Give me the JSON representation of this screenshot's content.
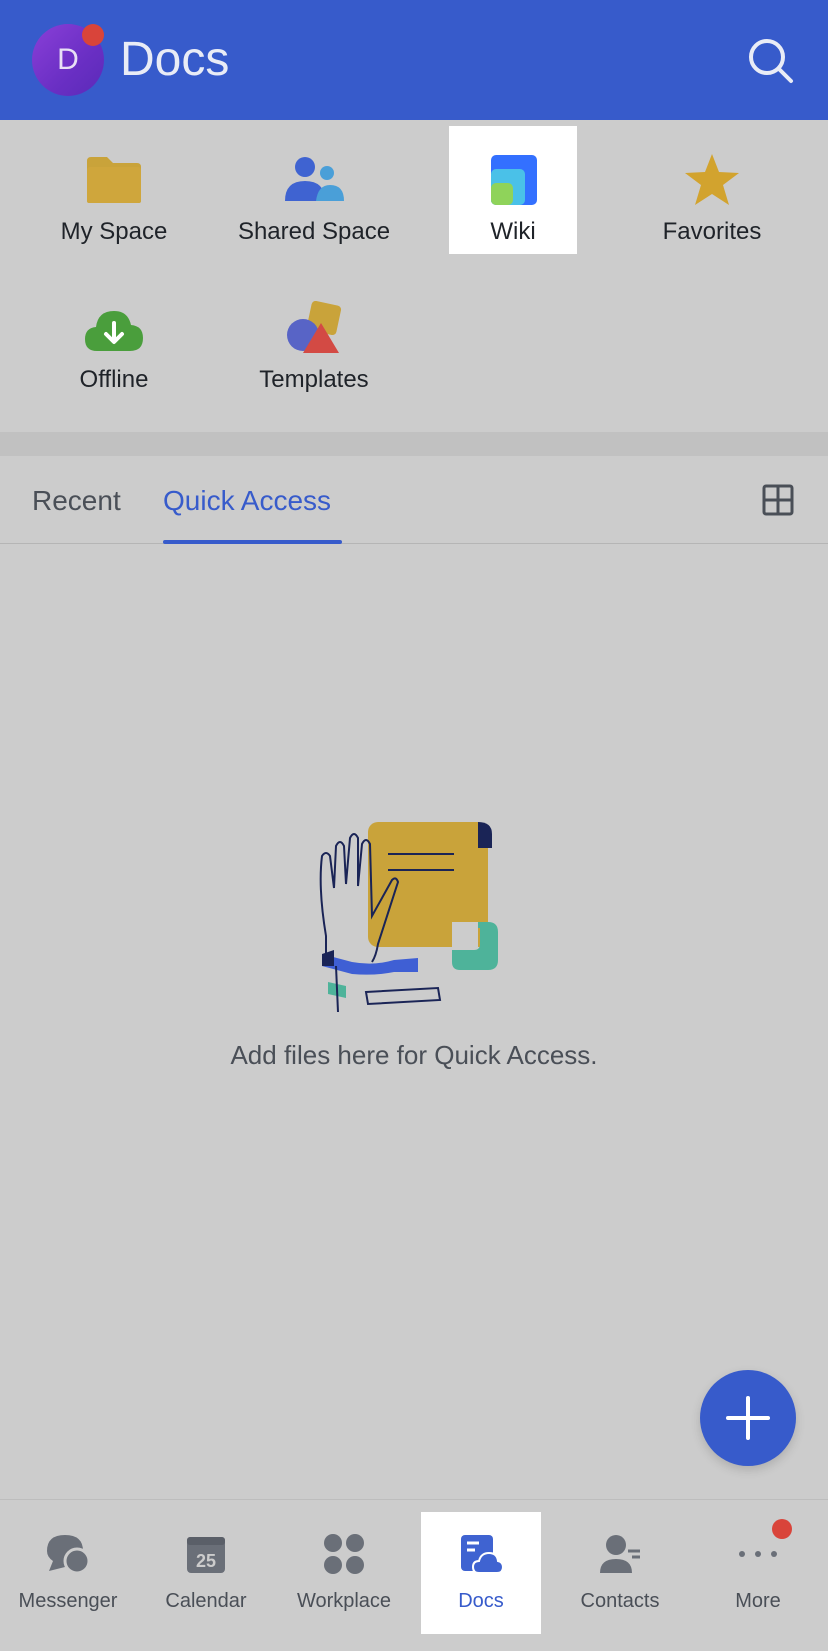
{
  "header": {
    "avatar_initial": "D",
    "title": "Docs",
    "colors": {
      "bar": "#375bcb",
      "notification_dot": "#d9443a"
    }
  },
  "quick_grid": {
    "items": [
      {
        "label": "My Space",
        "icon": "folder-icon"
      },
      {
        "label": "Shared Space",
        "icon": "people-icon"
      },
      {
        "label": "Wiki",
        "icon": "wiki-icon",
        "highlighted": true
      },
      {
        "label": "Favorites",
        "icon": "star-icon"
      },
      {
        "label": "Offline",
        "icon": "cloud-download-icon"
      },
      {
        "label": "Templates",
        "icon": "shapes-icon"
      }
    ]
  },
  "tabs": {
    "items": [
      {
        "label": "Recent",
        "active": false
      },
      {
        "label": "Quick Access",
        "active": true
      }
    ],
    "view_toggle_icon": "grid-view-icon"
  },
  "empty_state": {
    "message": "Add files here for Quick Access."
  },
  "fab": {
    "icon": "plus-icon"
  },
  "bottom_nav": {
    "items": [
      {
        "label": "Messenger",
        "icon": "chat-bubbles-icon"
      },
      {
        "label": "Calendar",
        "icon": "calendar-icon",
        "date": "25"
      },
      {
        "label": "Workplace",
        "icon": "apps-grid-icon"
      },
      {
        "label": "Docs",
        "icon": "docs-cloud-icon",
        "active": true
      },
      {
        "label": "Contacts",
        "icon": "contact-icon"
      },
      {
        "label": "More",
        "icon": "more-dots-icon",
        "has_badge": true
      }
    ],
    "colors": {
      "active": "#375bcb",
      "inactive": "#4a4f57"
    }
  }
}
